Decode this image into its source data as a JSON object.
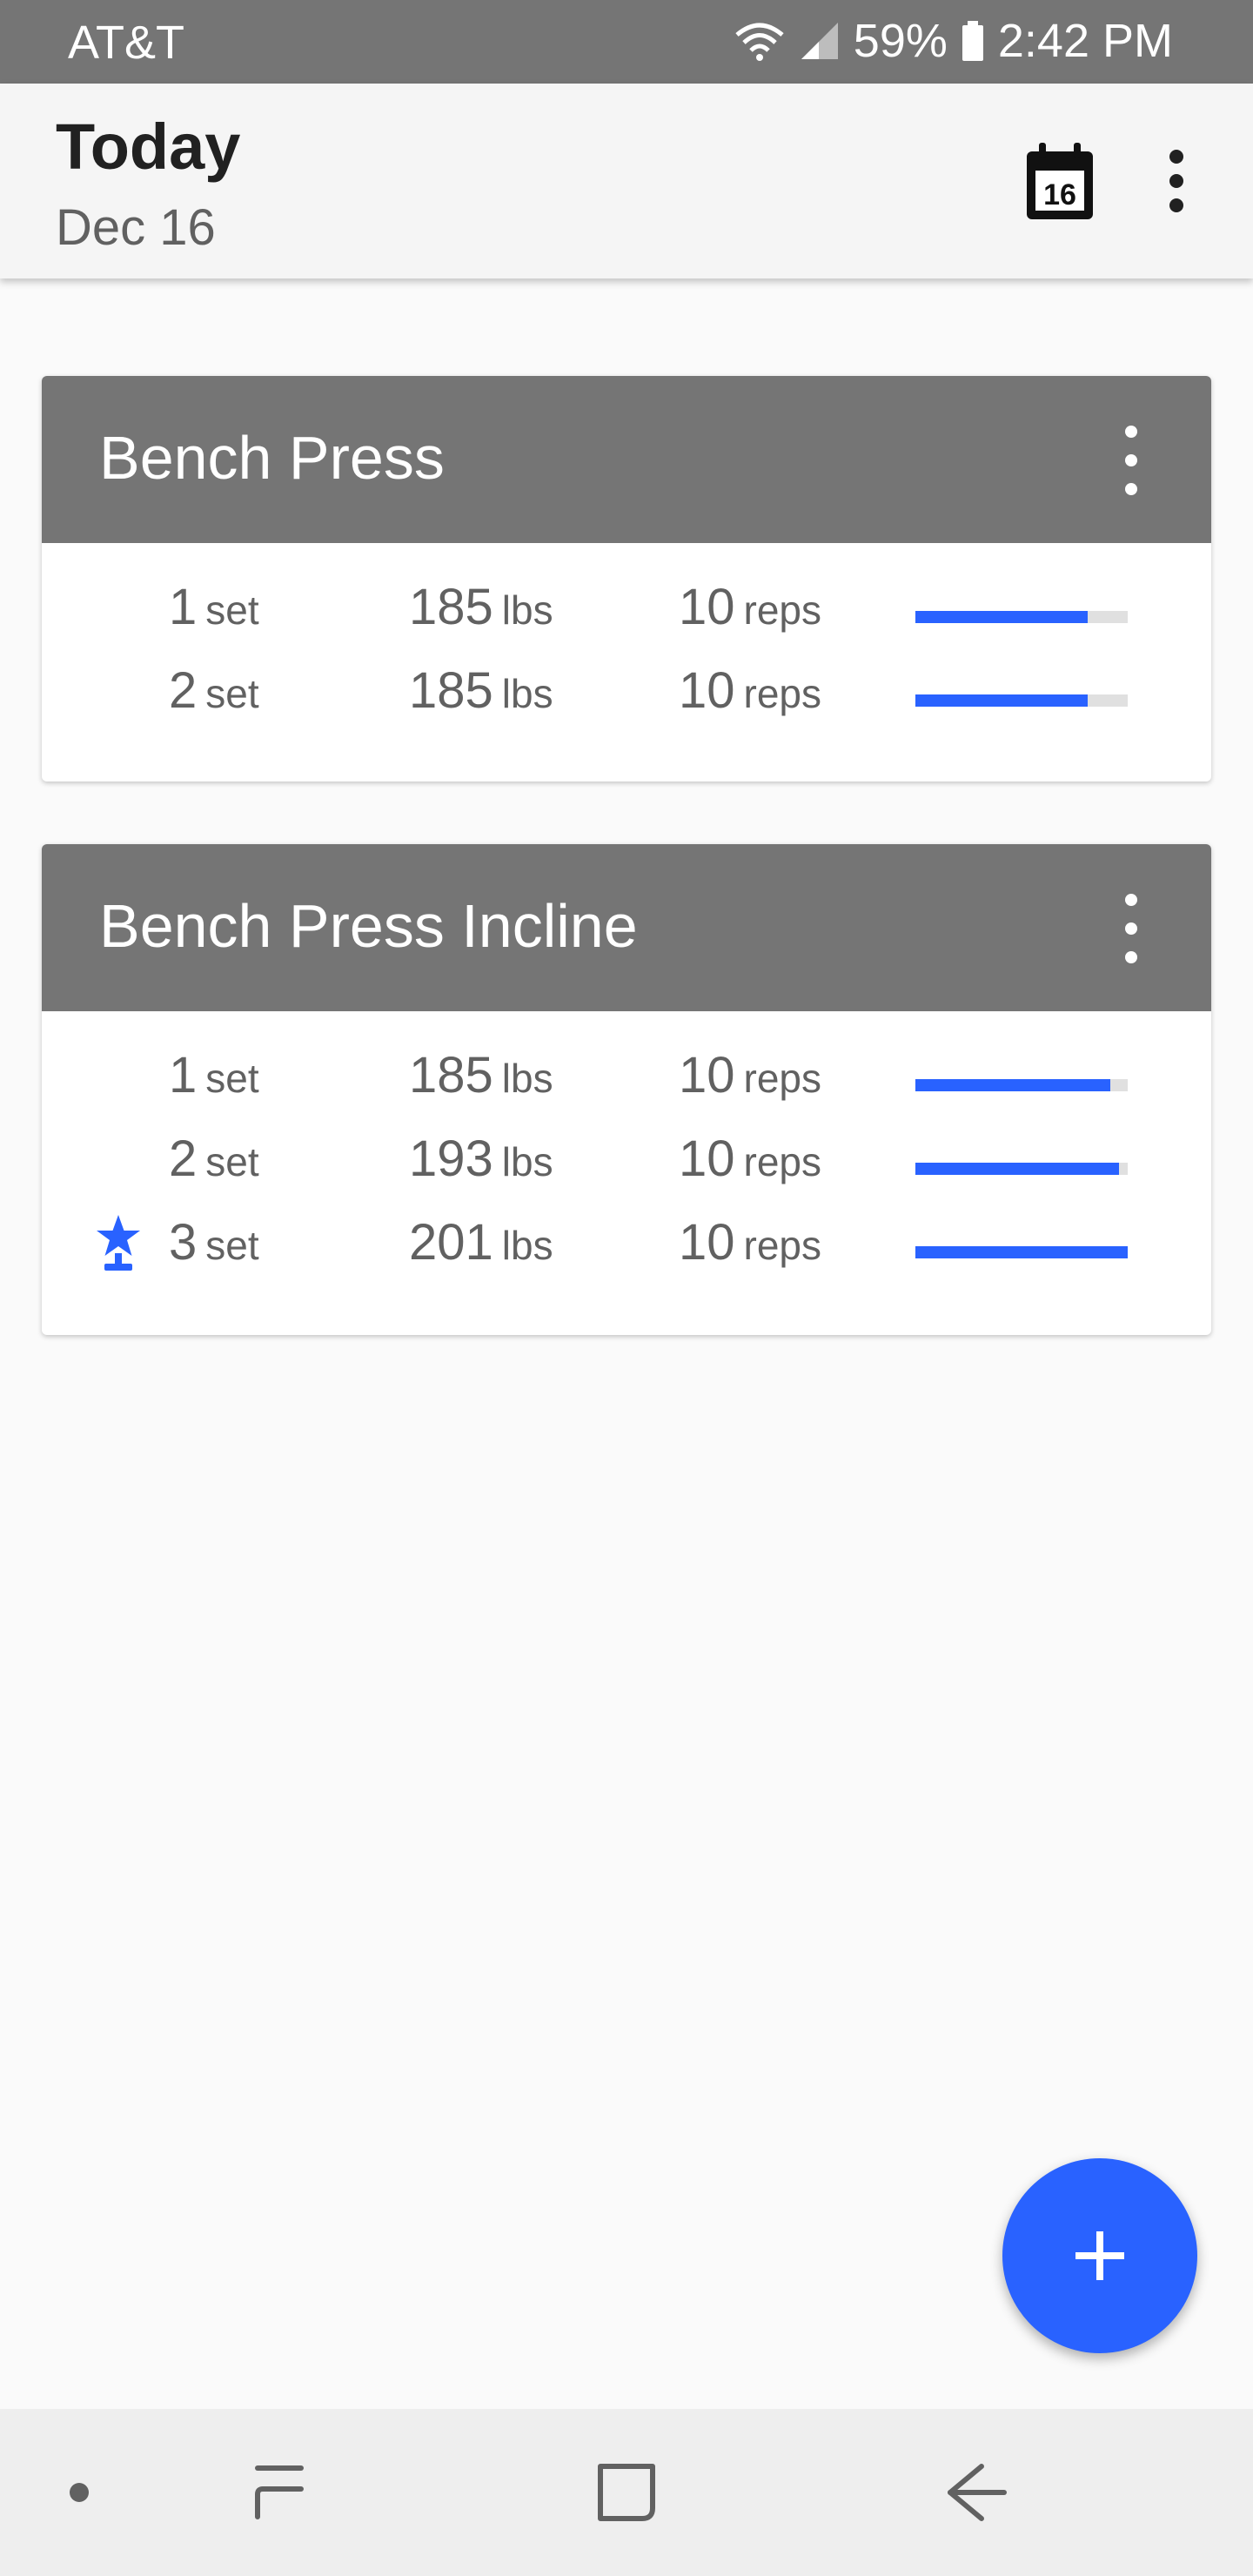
{
  "status_bar": {
    "carrier": "AT&T",
    "battery": "59%",
    "time": "2:42 PM"
  },
  "app_bar": {
    "title": "Today",
    "subtitle": "Dec 16",
    "calendar_day": "16"
  },
  "workouts": [
    {
      "title": "Bench Press",
      "sets": [
        {
          "set": "1",
          "set_unit": "set",
          "weight": "185",
          "weight_unit": "lbs",
          "reps": "10",
          "reps_unit": "reps",
          "progress": 0.81,
          "record": false
        },
        {
          "set": "2",
          "set_unit": "set",
          "weight": "185",
          "weight_unit": "lbs",
          "reps": "10",
          "reps_unit": "reps",
          "progress": 0.81,
          "record": false
        }
      ]
    },
    {
      "title": "Bench Press Incline",
      "sets": [
        {
          "set": "1",
          "set_unit": "set",
          "weight": "185",
          "weight_unit": "lbs",
          "reps": "10",
          "reps_unit": "reps",
          "progress": 0.92,
          "record": false
        },
        {
          "set": "2",
          "set_unit": "set",
          "weight": "193",
          "weight_unit": "lbs",
          "reps": "10",
          "reps_unit": "reps",
          "progress": 0.96,
          "record": false
        },
        {
          "set": "3",
          "set_unit": "set",
          "weight": "201",
          "weight_unit": "lbs",
          "reps": "10",
          "reps_unit": "reps",
          "progress": 1.0,
          "record": true
        }
      ]
    }
  ],
  "icons": {
    "calendar": "calendar-icon",
    "overflow": "more-vert-icon",
    "record": "trophy-star-icon",
    "fab": "add-icon"
  },
  "colors": {
    "accent": "#2962ff",
    "card_header": "#757575",
    "status_bar": "#757575",
    "bar_track": "#e0e0e0"
  }
}
